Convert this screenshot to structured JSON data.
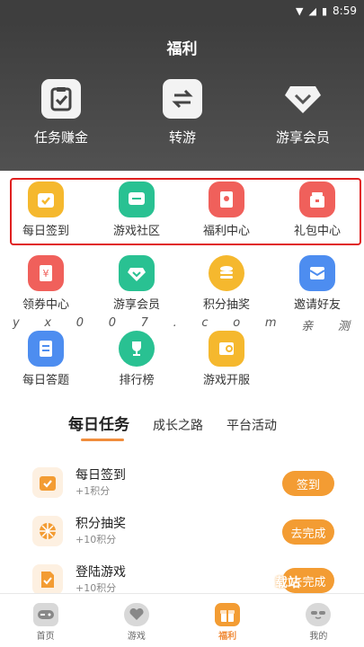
{
  "status_bar": {
    "time": "8:59"
  },
  "header": {
    "title": "福利"
  },
  "top_actions": [
    {
      "label": "任务赚金",
      "icon": "clipboard-check-icon"
    },
    {
      "label": "转游",
      "icon": "swap-arrows-icon"
    },
    {
      "label": "游享会员",
      "icon": "diamond-icon"
    }
  ],
  "grid": [
    {
      "label": "每日签到",
      "icon": "calendar-check-icon",
      "color": "#f5b82e"
    },
    {
      "label": "游戏社区",
      "icon": "chat-bubble-icon",
      "color": "#29c192"
    },
    {
      "label": "福利中心",
      "icon": "red-envelope-icon",
      "color": "#f0605b"
    },
    {
      "label": "礼包中心",
      "icon": "gift-box-icon",
      "color": "#f0605b"
    },
    {
      "label": "领券中心",
      "icon": "coupon-icon",
      "color": "#f0605b"
    },
    {
      "label": "游享会员",
      "icon": "diamond-icon",
      "color": "#29c192"
    },
    {
      "label": "积分抽奖",
      "icon": "coin-stack-icon",
      "color": "#f5b82e"
    },
    {
      "label": "邀请好友",
      "icon": "envelope-icon",
      "color": "#4d8df0"
    },
    {
      "label": "每日答题",
      "icon": "quiz-icon",
      "color": "#4d8df0"
    },
    {
      "label": "排行榜",
      "icon": "trophy-icon",
      "color": "#29c192"
    },
    {
      "label": "游戏开服",
      "icon": "server-icon",
      "color": "#f5b82e"
    }
  ],
  "watermark": [
    "y",
    "x",
    "0",
    "0",
    "7",
    ".",
    "c",
    "o",
    "m",
    "亲",
    "测"
  ],
  "tabs": [
    {
      "label": "每日任务",
      "active": true
    },
    {
      "label": "成长之路",
      "active": false
    },
    {
      "label": "平台活动",
      "active": false
    }
  ],
  "tasks": [
    {
      "title": "每日签到",
      "reward": "+1积分",
      "button": "签到",
      "icon": "calendar-check-icon"
    },
    {
      "title": "积分抽奖",
      "reward": "+10积分",
      "button": "去完成",
      "icon": "wheel-icon"
    },
    {
      "title": "登陆游戏",
      "reward": "+10积分",
      "button": "去完成",
      "icon": "document-icon"
    }
  ],
  "corner_watermark": "载站",
  "bottom_nav": [
    {
      "label": "首页",
      "icon": "gamepad-icon",
      "active": false
    },
    {
      "label": "游戏",
      "icon": "heart-icon",
      "active": false
    },
    {
      "label": "福利",
      "icon": "gift-icon",
      "active": true
    },
    {
      "label": "我的",
      "icon": "face-icon",
      "active": false
    }
  ],
  "colors": {
    "accent": "#f08d3c",
    "button": "#f39c33",
    "header": "#3e3e3e",
    "highlight": "#e02020"
  }
}
